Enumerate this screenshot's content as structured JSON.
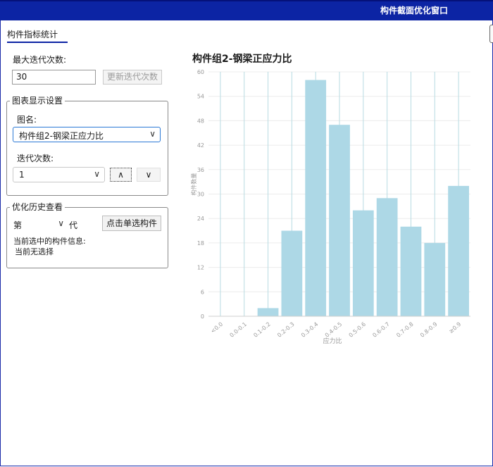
{
  "window": {
    "title": "构件截面优化窗口"
  },
  "tabs": [
    {
      "label": "构件指标统计",
      "active": true
    }
  ],
  "left_panel": {
    "max_iter_label": "最大迭代次数:",
    "max_iter_value": "30",
    "update_button": "更新迭代次数",
    "chart_settings": {
      "title": "图表显示设置",
      "chart_name_label": "图名:",
      "chart_name_value": "构件组2-钢梁正应力比",
      "iteration_label": "迭代次数:",
      "iteration_value": "1",
      "up_icon": "chevron-up-icon",
      "down_icon": "chevron-down-icon"
    },
    "history": {
      "title": "优化历史查看",
      "gen_prefix": "第",
      "gen_value": "",
      "gen_suffix": "代",
      "pick_button": "点击单选构件",
      "info_label": "当前选中的构件信息:",
      "info_value": "当前无选择"
    }
  },
  "chart_data": {
    "type": "bar",
    "title": "构件组2-钢梁正应力比",
    "xlabel": "应力比",
    "ylabel": "构件数量",
    "categories": [
      "<0.0",
      "0.0-0.1",
      "0.1-0.2",
      "0.2-0.3",
      "0.3-0.4",
      "0.4-0.5",
      "0.5-0.6",
      "0.6-0.7",
      "0.7-0.8",
      "0.8-0.9",
      "≥0.9"
    ],
    "values": [
      0,
      0,
      2,
      21,
      58,
      47,
      26,
      29,
      22,
      18,
      32
    ],
    "ylim": [
      0,
      60
    ],
    "yticks": [
      0,
      6,
      12,
      18,
      24,
      30,
      36,
      42,
      48,
      54,
      60
    ],
    "bar_color": "#add8e6",
    "grid": true
  }
}
